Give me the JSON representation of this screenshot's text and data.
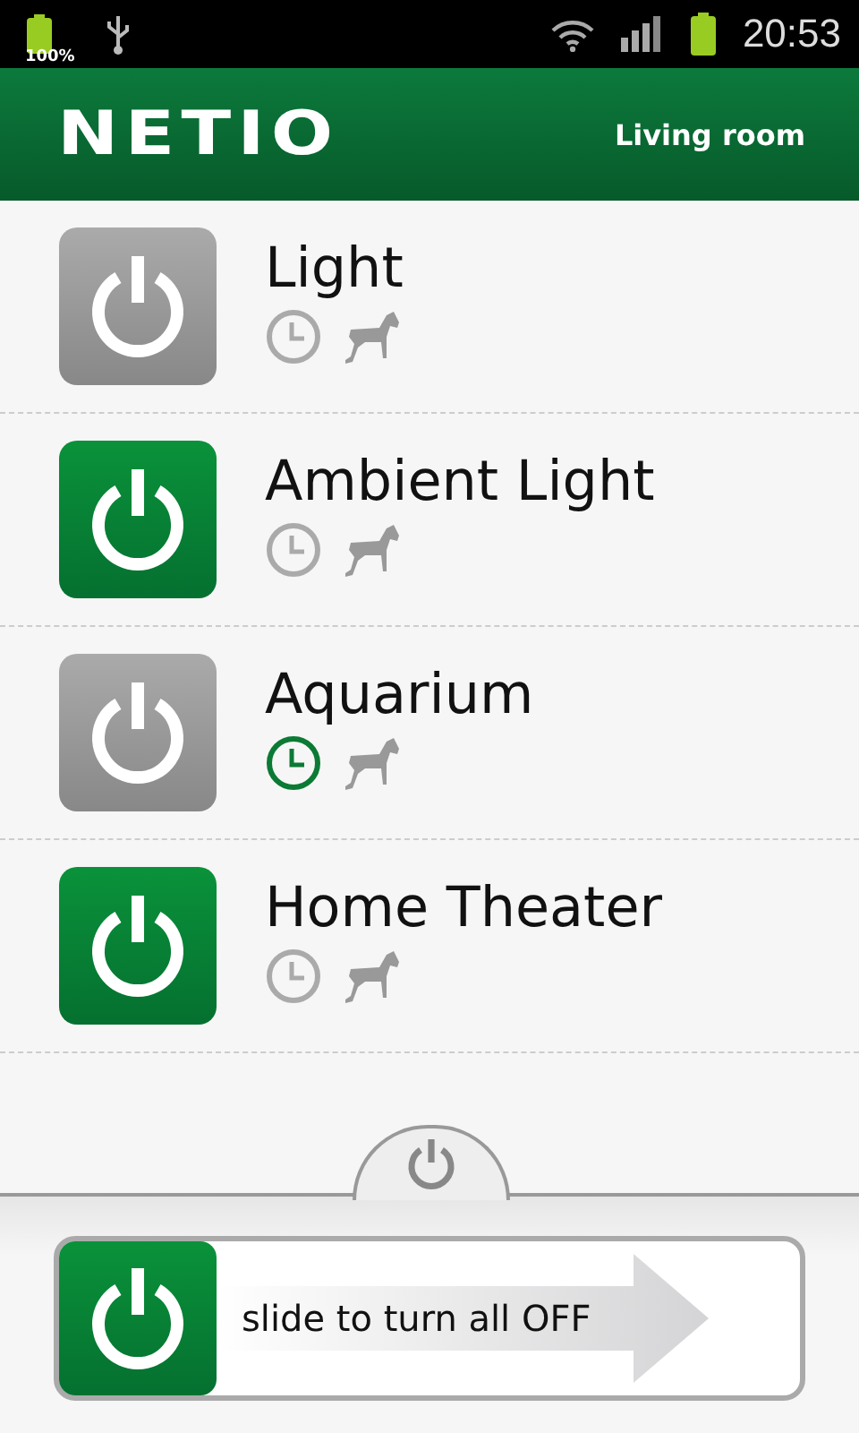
{
  "status_bar": {
    "battery_label": "100%",
    "time": "20:53"
  },
  "header": {
    "logo": "NETIO",
    "room": "Living room"
  },
  "devices": [
    {
      "name": "Light",
      "on": false,
      "timer_active": false
    },
    {
      "name": "Ambient Light",
      "on": true,
      "timer_active": false
    },
    {
      "name": "Aquarium",
      "on": false,
      "timer_active": true
    },
    {
      "name": "Home Theater",
      "on": true,
      "timer_active": false
    }
  ],
  "slider": {
    "label": "slide to turn all OFF",
    "level": 0
  }
}
